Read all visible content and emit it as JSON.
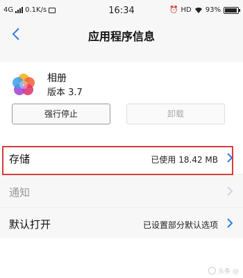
{
  "status_bar": {
    "network": "4G",
    "speed": "0.1K/s",
    "time": "16:34",
    "hd": "HD",
    "battery": "93%",
    "battery_level": 0.93
  },
  "nav": {
    "back_icon": "chevron-left-icon",
    "title": "应用程序信息"
  },
  "app": {
    "name": "相册",
    "version": "版本 3.7",
    "icon": "photos-flower-icon"
  },
  "actions": {
    "force_stop": "强行停止",
    "uninstall": "卸载"
  },
  "settings": [
    {
      "label": "存储",
      "value": "已使用 18.42 MB",
      "enabled": true,
      "highlighted": true
    },
    {
      "label": "通知",
      "value": "",
      "enabled": false
    },
    {
      "label": "默认打开",
      "value": "已设置部分默认选项",
      "enabled": true
    }
  ],
  "colors": {
    "accent": "#2d7fe0",
    "highlight_border": "#d93a3a",
    "disabled": "#999999"
  },
  "watermark": "头条 @"
}
